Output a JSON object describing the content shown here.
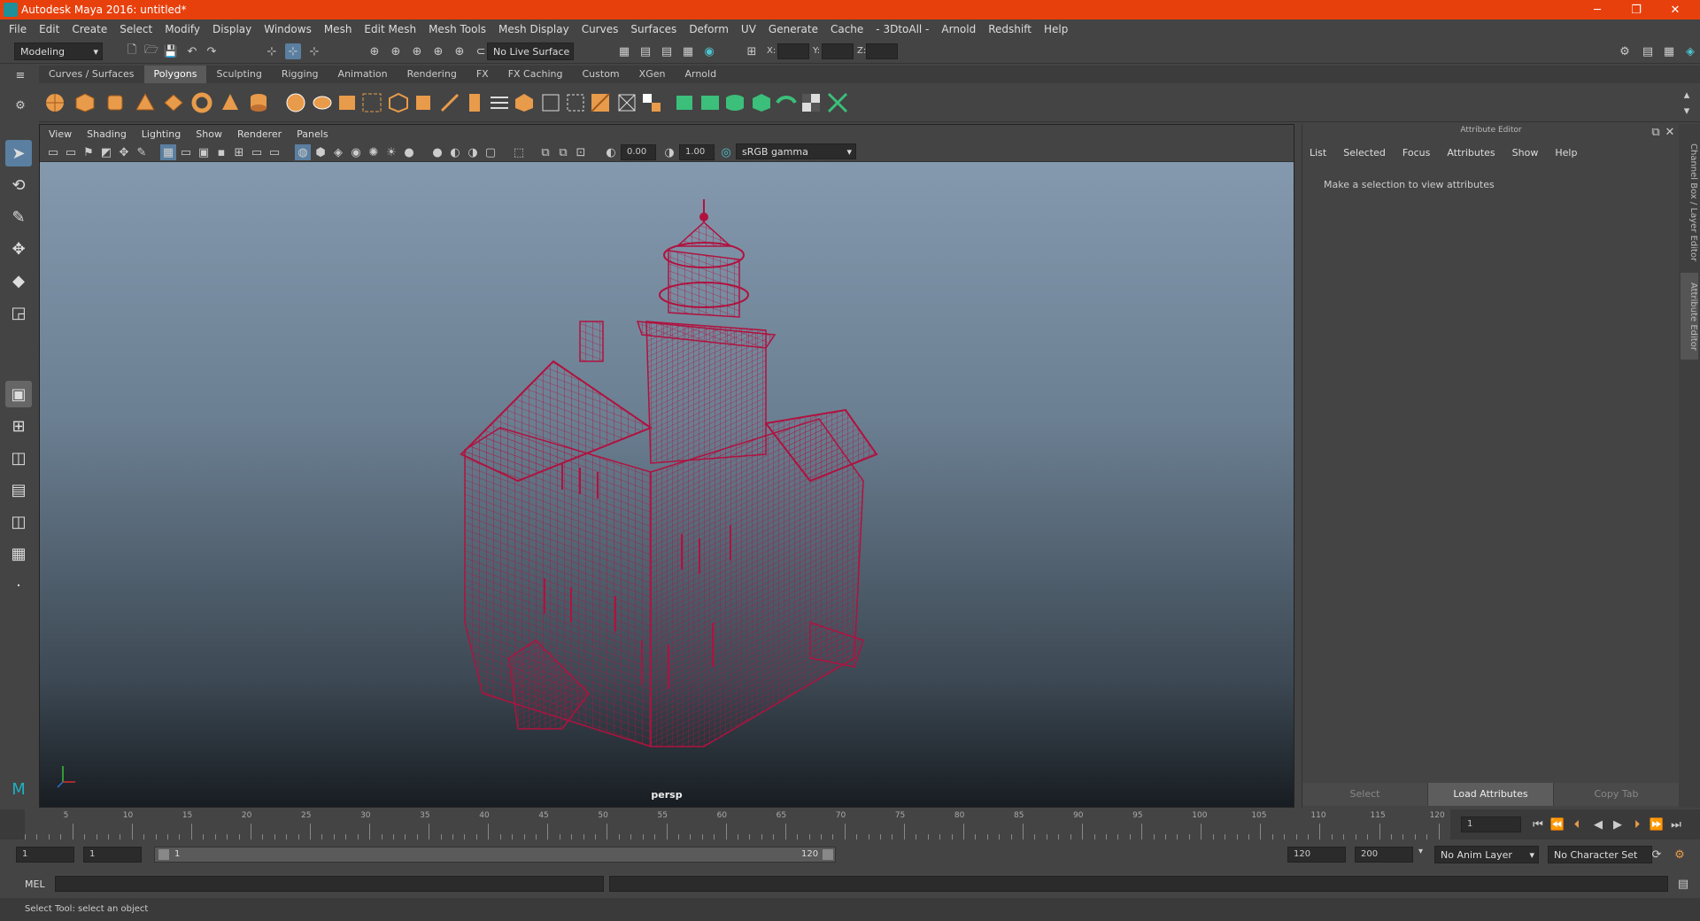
{
  "window": {
    "title": "Autodesk Maya 2016: untitled*"
  },
  "menubar": [
    "File",
    "Edit",
    "Create",
    "Select",
    "Modify",
    "Display",
    "Windows",
    "Mesh",
    "Edit Mesh",
    "Mesh Tools",
    "Mesh Display",
    "Curves",
    "Surfaces",
    "Deform",
    "UV",
    "Generate",
    "Cache",
    "- 3DtoAll -",
    "Arnold",
    "Redshift",
    "Help"
  ],
  "statusline": {
    "mode": "Modeling",
    "live_surface": "No Live Surface",
    "x_label": "X:",
    "y_label": "Y:",
    "z_label": "Z:"
  },
  "shelf_tabs": [
    {
      "label": "Curves / Surfaces",
      "active": false
    },
    {
      "label": "Polygons",
      "active": true
    },
    {
      "label": "Sculpting",
      "active": false
    },
    {
      "label": "Rigging",
      "active": false
    },
    {
      "label": "Animation",
      "active": false
    },
    {
      "label": "Rendering",
      "active": false
    },
    {
      "label": "FX",
      "active": false
    },
    {
      "label": "FX Caching",
      "active": false
    },
    {
      "label": "Custom",
      "active": false
    },
    {
      "label": "XGen",
      "active": false
    },
    {
      "label": "Arnold",
      "active": false
    }
  ],
  "viewport": {
    "menu": [
      "View",
      "Shading",
      "Lighting",
      "Show",
      "Renderer",
      "Panels"
    ],
    "exposure": "0.00",
    "gamma": "1.00",
    "color_space": "sRGB gamma",
    "camera": "persp",
    "wire_color": "#b0123f"
  },
  "attribute_editor": {
    "title": "Attribute Editor",
    "menu": [
      "List",
      "Selected",
      "Focus",
      "Attributes",
      "Show",
      "Help"
    ],
    "message": "Make a selection to view attributes",
    "buttons": [
      {
        "label": "Select",
        "active": false
      },
      {
        "label": "Load Attributes",
        "active": true
      },
      {
        "label": "Copy Tab",
        "active": false
      }
    ]
  },
  "side_tabs": [
    "Channel Box / Layer Editor",
    "Attribute Editor"
  ],
  "timeline": {
    "ticks": [
      5,
      10,
      15,
      20,
      25,
      30,
      35,
      40,
      45,
      50,
      55,
      60,
      65,
      70,
      75,
      80,
      85,
      90,
      95,
      100,
      105,
      110,
      115,
      120
    ],
    "start_label": "1",
    "current_frame": "1"
  },
  "range": {
    "start": "1",
    "playback_start": "1",
    "slider_start": "1",
    "slider_end": "120",
    "playback_end": "120",
    "end": "200",
    "anim_layer": "No Anim Layer",
    "character_set": "No Character Set"
  },
  "command": {
    "label": "MEL"
  },
  "help_line": "Select Tool: select an object"
}
